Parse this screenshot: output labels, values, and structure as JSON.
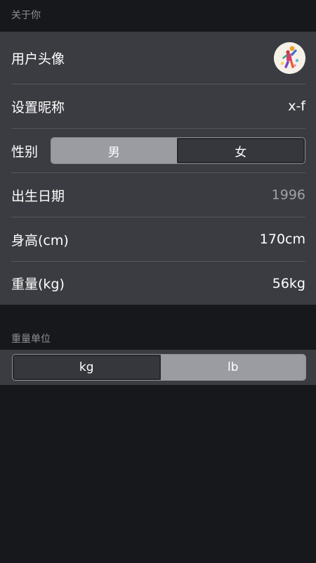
{
  "about_section": {
    "header": "关于你"
  },
  "profile": {
    "avatar_label": "用户头像",
    "nickname_label": "设置昵称",
    "nickname_value": "x-f",
    "gender_label": "性别",
    "gender_options": [
      "男",
      "女"
    ],
    "gender_selected": "男",
    "birth_label": "出生日期",
    "birth_value": "1996",
    "height_label": "身高(cm)",
    "height_value": "170cm",
    "weight_label": "重量(kg)",
    "weight_value": "56kg"
  },
  "unit_section": {
    "header": "重量单位",
    "options": [
      "kg",
      "lb"
    ],
    "selected": "lb"
  },
  "colors": {
    "background": "#17181b",
    "card": "#3b3c41",
    "selected_segment": "#9b9ca2",
    "header_text": "#8f9096"
  }
}
